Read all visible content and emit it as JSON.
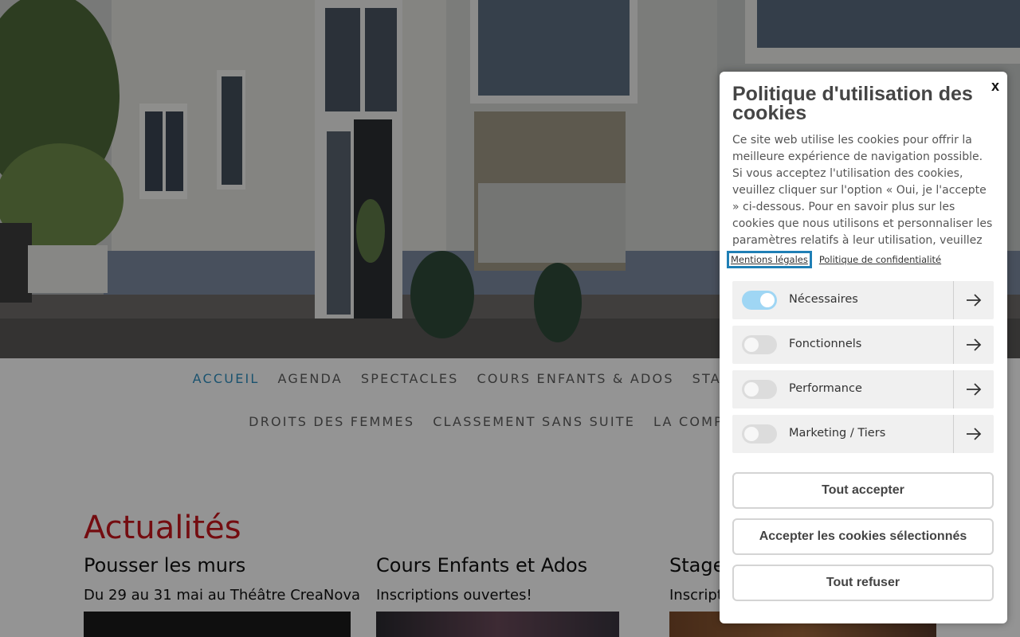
{
  "nav": {
    "row1": [
      {
        "label": "ACCUEIL",
        "active": true
      },
      {
        "label": "AGENDA",
        "active": false
      },
      {
        "label": "SPECTACLES",
        "active": false
      },
      {
        "label": "COURS ENFANTS & ADOS",
        "active": false
      },
      {
        "label": "STAGES ADULTES",
        "active": false
      }
    ],
    "row2": [
      {
        "label": "DROITS DES FEMMES",
        "active": false
      },
      {
        "label": "CLASSEMENT SANS SUITE",
        "active": false
      },
      {
        "label": "LA COMPAGNIE",
        "active": false
      }
    ]
  },
  "content": {
    "section_title": "Actualités",
    "cards": [
      {
        "title": "Pousser les murs",
        "subtitle": "Du 29 au 31 mai au Théâtre CreaNova"
      },
      {
        "title": "Cours Enfants et Ados",
        "subtitle": "Inscriptions ouvertes!"
      },
      {
        "title": "Stages",
        "subtitle": "Inscriptions"
      }
    ]
  },
  "cookie_panel": {
    "close_label": "x",
    "title": "Politique d'utilisation des cookies",
    "body": "Ce site web utilise les cookies pour offrir la meilleure expérience de navigation possible. Si vous acceptez l'utilisation des cookies, veuillez cliquer sur l'option « Oui, je l'accepte » ci-dessous. Pour en savoir plus sur les cookies que nous utilisons et personnaliser les paramètres relatifs à leur utilisation, veuillez",
    "links": {
      "legal": "Mentions légales",
      "privacy": "Politique de confidentialité"
    },
    "categories": [
      {
        "label": "Nécessaires",
        "enabled": true
      },
      {
        "label": "Fonctionnels",
        "enabled": false
      },
      {
        "label": "Performance",
        "enabled": false
      },
      {
        "label": "Marketing / Tiers",
        "enabled": false
      }
    ],
    "buttons": {
      "accept_all": "Tout accepter",
      "accept_selected": "Accepter les cookies sélectionnés",
      "reject_all": "Tout refuser"
    }
  },
  "colors": {
    "accent": "#2f8fc0",
    "heading_red": "#c8161d",
    "toggle_on": "#9fd6f4"
  }
}
